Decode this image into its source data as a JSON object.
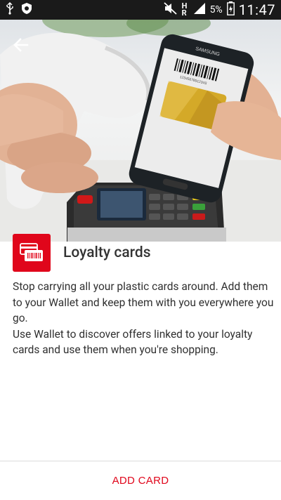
{
  "status_bar": {
    "battery_percent": "5%",
    "time": "11:47",
    "signal_label": "H R"
  },
  "hero": {
    "phone_brand": "SAMSUNG",
    "barcode_number": "1234567891234S"
  },
  "card_info": {
    "icon": "loyalty-card-icon",
    "title": "Loyalty cards",
    "paragraph1": "Stop carrying all your plastic cards around. Add them to your Wallet and keep them with you everywhere you go.",
    "paragraph2": "Use Wallet to discover offers linked to your loyalty cards and use them when you're shopping."
  },
  "footer": {
    "add_card_label": "ADD CARD"
  },
  "colors": {
    "accent": "#e0061b",
    "status_bar": "#1a1a1a"
  }
}
